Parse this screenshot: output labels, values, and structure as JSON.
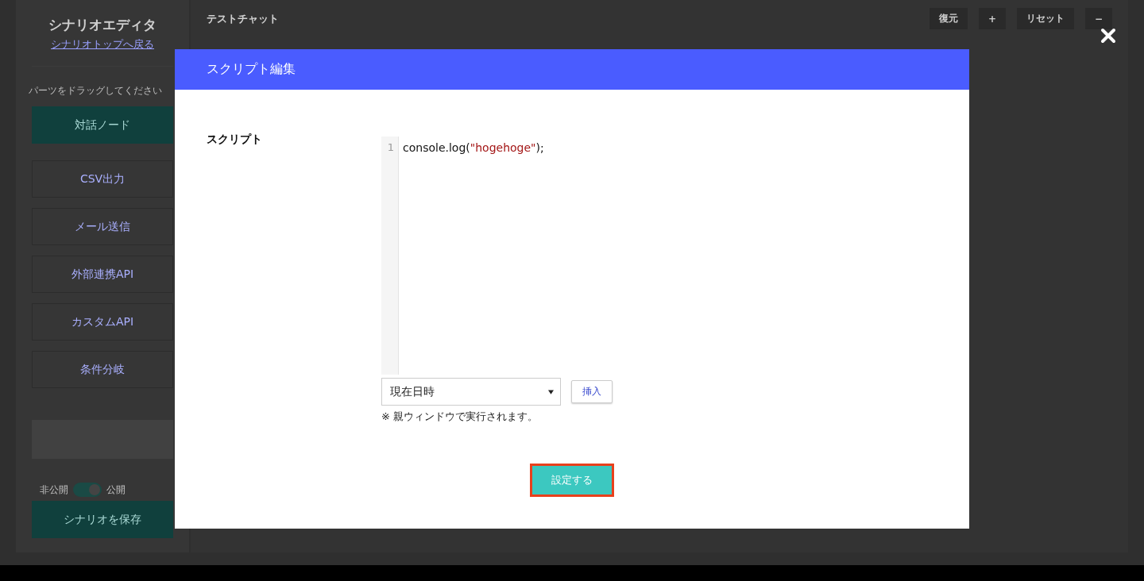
{
  "sidebar": {
    "title": "シナリオエディタ",
    "back_link": "シナリオトップへ戻る",
    "hint": "パーツをドラッグしてください",
    "parts": [
      {
        "label": "対話ノード",
        "kind": "primary"
      },
      {
        "label": "CSV出力",
        "kind": "outline"
      },
      {
        "label": "メール送信",
        "kind": "outline"
      },
      {
        "label": "外部連携API",
        "kind": "outline"
      },
      {
        "label": "カスタムAPI",
        "kind": "outline"
      },
      {
        "label": "条件分岐",
        "kind": "outline"
      }
    ],
    "toggle": {
      "off_label": "非公開",
      "on_label": "公開",
      "on": true
    },
    "save_button": "シナリオを保存"
  },
  "main": {
    "title": "テストチャット",
    "toolbar": [
      "復元",
      "+",
      "リセット",
      "−"
    ]
  },
  "modal": {
    "title": "スクリプト編集",
    "field_label": "スクリプト",
    "code_lines": [
      {
        "number": "1",
        "tokens": [
          {
            "text": "console.log(",
            "kind": "plain"
          },
          {
            "text": "\"hogehoge\"",
            "kind": "string"
          },
          {
            "text": ");",
            "kind": "plain"
          }
        ]
      }
    ],
    "select": {
      "value": "現在日時"
    },
    "insert_button": "挿入",
    "note": "※ 親ウィンドウで実行されます。",
    "submit_button": {
      "label": "設定する",
      "focused": true
    }
  }
}
